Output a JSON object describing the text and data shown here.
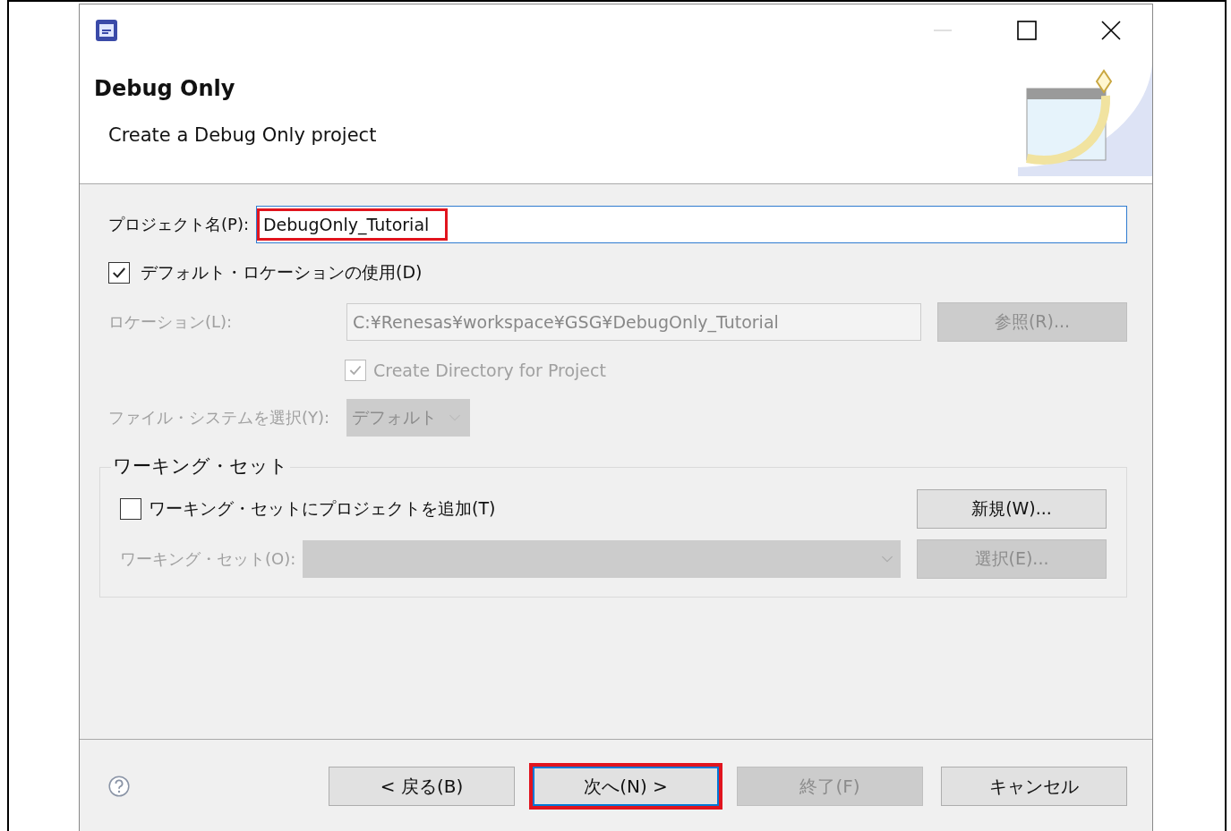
{
  "window": {
    "title": "Debug Only",
    "subtitle": "Create a Debug Only project"
  },
  "project_name": {
    "label": "プロジェクト名(P):",
    "value": "DebugOnly_Tutorial",
    "highlighted": true
  },
  "use_default_location": {
    "label": "デフォルト・ロケーションの使用(D)",
    "checked": true
  },
  "location": {
    "label": "ロケーション(L):",
    "value": "C:¥Renesas¥workspace¥GSG¥DebugOnly_Tutorial",
    "disabled": true,
    "button": "参照(R)..."
  },
  "create_directory": {
    "label": "Create Directory for Project",
    "checked": true,
    "disabled": true
  },
  "file_system": {
    "label": "ファイル・システムを選択(Y):",
    "value": "デフォルト",
    "disabled": true
  },
  "working_set": {
    "title": "ワーキング・セット",
    "add": {
      "label": "ワーキング・セットにプロジェクトを追加(T)",
      "checked": false
    },
    "new_button": "新規(W)...",
    "set_label": "ワーキング・セット(O):",
    "select_button": "選択(E)...",
    "disabled": true
  },
  "buttons": [
    {
      "label": "< 戻る(B)",
      "disabled": false,
      "highlighted": false,
      "focused": false
    },
    {
      "label": "次へ(N) >",
      "disabled": false,
      "highlighted": true,
      "focused": true
    },
    {
      "label": "終了(F)",
      "disabled": true,
      "highlighted": false,
      "focused": false
    },
    {
      "label": "キャンセル",
      "disabled": false,
      "highlighted": false,
      "focused": false
    }
  ]
}
